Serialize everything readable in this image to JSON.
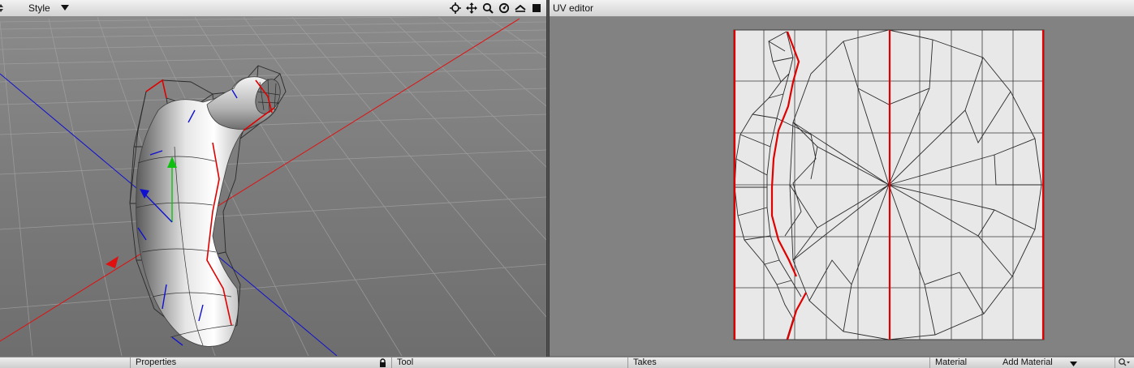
{
  "viewport": {
    "style_menu_label": "Style",
    "icons": [
      "move-target-icon",
      "pan-icon",
      "zoom-icon",
      "rotate-icon",
      "fit-icon",
      "fullscreen-icon"
    ]
  },
  "uv_editor": {
    "title": "UV editor"
  },
  "bottom": {
    "properties_label": "Properties",
    "tool_label": "Tool",
    "takes_label": "Takes",
    "material_label": "Material",
    "add_material_label": "Add Material"
  },
  "colors": {
    "axis_x": "#e01010",
    "axis_z": "#1010d0",
    "axis_y": "#10c010",
    "seam": "#e00000",
    "uv_background": "#e8e8e8"
  }
}
